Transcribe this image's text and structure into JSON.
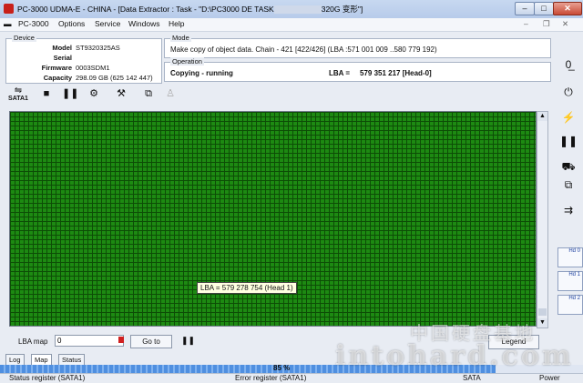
{
  "titlebar": {
    "title": "PC-3000 UDMA-E - CHINA - [Data Extractor : Task - \"D:\\PC3000 DE TASK",
    "title_tail": "320G 变形\"]",
    "min": "–",
    "max": "□",
    "close": "✕"
  },
  "menubar": {
    "items": [
      "PC-3000",
      "Options",
      "Service",
      "Windows",
      "Help"
    ]
  },
  "device": {
    "title": "Device",
    "model_label": "Model",
    "model": "ST9320325AS",
    "serial_label": "Serial",
    "serial": "",
    "firmware_label": "Firmware",
    "firmware": "0003SDM1",
    "capacity_label": "Capacity",
    "capacity": "298.09 GB (625 142 447)"
  },
  "mode": {
    "title": "Mode",
    "text": "Make copy of object data. Chain - 421 [422/426] (LBA :571 001 009 ..580 779 192)"
  },
  "operation": {
    "title": "Operation",
    "status": "Copying - running",
    "lba_label": "LBA =",
    "lba": "579 351 217  [Head-0]"
  },
  "toolbar": {
    "sata_label": "SATA1",
    "icons": [
      "sata-icon",
      "stop-icon",
      "pause-icon",
      "settings-icon",
      "tools-icon",
      "copy-icon",
      "walk-icon"
    ]
  },
  "map": {
    "tooltip": "LBA =   579 278 754  (Head 1)",
    "scroll_up": "▲",
    "scroll_down": "▼"
  },
  "bottom": {
    "lba_map_label": "LBA map",
    "lba_input": "0",
    "goto_label": "Go to",
    "legend_label": "Legend"
  },
  "tabs": [
    "Log",
    "Map",
    "Status"
  ],
  "progress": {
    "percent": 85,
    "text": "85 %"
  },
  "statusbar": {
    "status_register": "Status register (SATA1)",
    "error_register": "Error register (SATA1)",
    "sata": "SATA",
    "power": "Power"
  },
  "rightbar": {
    "hd0": "Hd 0",
    "hd1": "Hd 1",
    "hd2": "Hd 2"
  },
  "watermark": {
    "cn": "中国硬盘基地",
    "en": "intohard.com"
  },
  "colors": {
    "map_green": "#1d8a12",
    "map_grid": "#0d4d06",
    "title_accent": "#c8201a"
  }
}
